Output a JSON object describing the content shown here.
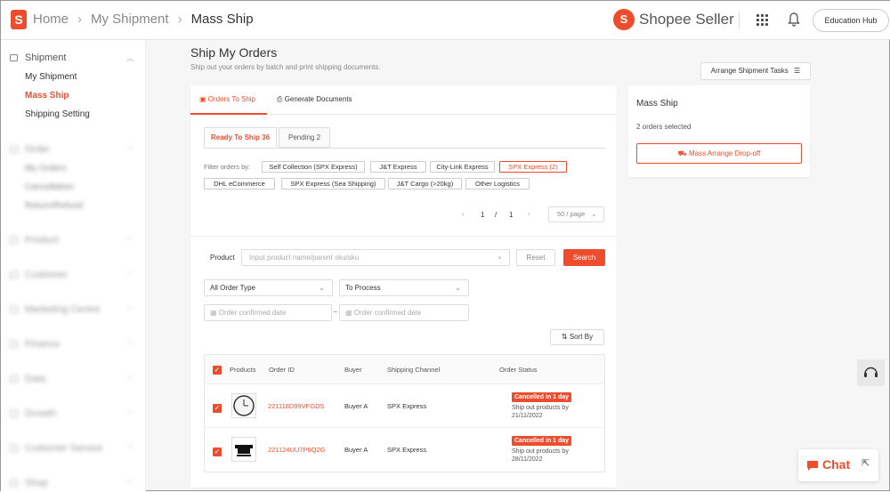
{
  "header": {
    "breadcrumb": [
      "Home",
      "My Shipment",
      "Mass Ship"
    ],
    "brand": "Shopee Seller",
    "edu_hub": "Education Hub"
  },
  "sidebar": {
    "section": "Shipment",
    "items": [
      "My Shipment",
      "Mass Ship",
      "Shipping Setting"
    ],
    "active": "Mass Ship",
    "blurred": [
      "Order",
      "My Orders",
      "Cancellation",
      "Return/Refund",
      "Product",
      "Customer",
      "Marketing Centre",
      "Finance",
      "Data",
      "Growth",
      "Customer Service",
      "Shop"
    ]
  },
  "page": {
    "title": "Ship My Orders",
    "subtitle": "Ship out your orders by batch and print shipping documents.",
    "arrange_tasks": "Arrange Shipment Tasks"
  },
  "tabs": {
    "orders_to_ship": "Orders To Ship",
    "generate_documents": "Generate Documents"
  },
  "subtabs": {
    "ready": "Ready To Ship 36",
    "pending": "Pending 2"
  },
  "filters": {
    "label": "Filter orders by:",
    "chips": [
      "Self Collection (SPX Express)",
      "J&T Express",
      "City-Link Express",
      "SPX Express (2)",
      "DHL eCommerce",
      "SPX Express (Sea Shipping)",
      "J&T Cargo (>20kg)",
      "Other Logistics"
    ],
    "active": "SPX Express (2)"
  },
  "pagination": {
    "current": "1",
    "separator": "/",
    "total": "1",
    "per_page": "50 / page"
  },
  "search": {
    "product_label": "Product",
    "placeholder": "Input product name/parent sku/sku",
    "reset": "Reset",
    "search": "Search",
    "order_type": "All Order Type",
    "process": "To Process",
    "date_start": "Order confirmed date",
    "date_end": "Order confirmed date",
    "date_sep": "–",
    "sort_by": "Sort By"
  },
  "table": {
    "headers": [
      "Products",
      "Order ID",
      "Buyer",
      "Shipping Channel",
      "Order Status"
    ],
    "rows": [
      {
        "order_id": "221118D99VFGDS",
        "buyer": "Buyer A",
        "channel": "SPX Express",
        "status": "Cancelled in 1 day",
        "note1": "Ship out products by",
        "note2": "21/11/2022"
      },
      {
        "order_id": "221124UU7P6Q2G",
        "buyer": "Buyer A",
        "channel": "SPX Express",
        "status": "Cancelled in 1 day",
        "note1": "Ship out products by",
        "note2": "28/11/2022"
      }
    ]
  },
  "mass_ship": {
    "title": "Mass Ship",
    "selected": "2 orders selected",
    "button": "Mass Arrange Drop-off"
  },
  "chat": {
    "label": "Chat"
  },
  "colors": {
    "accent": "#ee4d2d",
    "background": "#f6f6f6"
  }
}
